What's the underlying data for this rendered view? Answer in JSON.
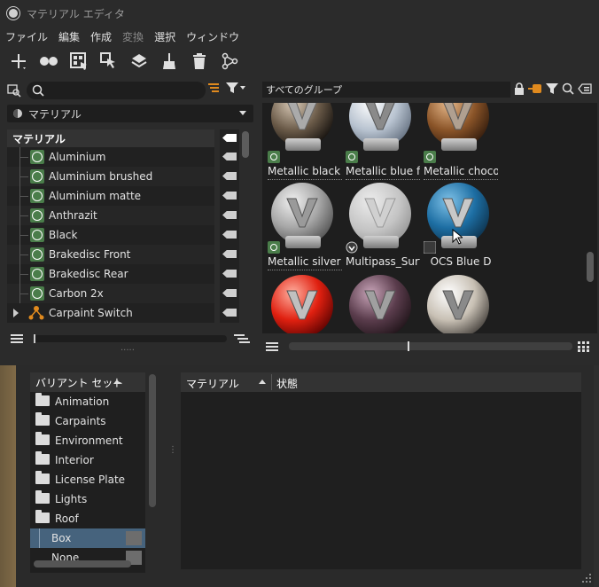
{
  "window": {
    "title": "マテリアル エディタ"
  },
  "menu": [
    {
      "label": "ファイル",
      "enabled": true
    },
    {
      "label": "編集",
      "enabled": true
    },
    {
      "label": "作成",
      "enabled": true
    },
    {
      "label": "変換",
      "enabled": false
    },
    {
      "label": "選択",
      "enabled": true
    },
    {
      "label": "ウィンドウ",
      "enabled": true
    }
  ],
  "toolbar": [
    {
      "name": "add-icon"
    },
    {
      "name": "group-icon"
    },
    {
      "name": "select-icon"
    },
    {
      "name": "pick-icon"
    },
    {
      "name": "assign-icon"
    },
    {
      "name": "sweep-icon"
    },
    {
      "name": "delete-icon"
    },
    {
      "name": "graph-icon"
    }
  ],
  "left": {
    "search_placeholder": "",
    "dropdown": "マテリアル",
    "tree_header": "マテリアル",
    "items": [
      {
        "label": "Aluminium",
        "type": "material"
      },
      {
        "label": "Aluminium brushed",
        "type": "material"
      },
      {
        "label": "Aluminium matte",
        "type": "material"
      },
      {
        "label": "Anthrazit",
        "type": "material"
      },
      {
        "label": "Black",
        "type": "material"
      },
      {
        "label": "Brakedisc Front",
        "type": "material"
      },
      {
        "label": "Brakedisc Rear",
        "type": "material"
      },
      {
        "label": "Carbon 2x",
        "type": "material"
      },
      {
        "label": "Carpaint Switch",
        "type": "switch"
      }
    ]
  },
  "right": {
    "group": "すべてのグループ",
    "materials": [
      {
        "label": "Metallic black",
        "checked": true
      },
      {
        "label": "Metallic blue fi",
        "checked": true
      },
      {
        "label": "Metallic chocol",
        "checked": true
      },
      {
        "label": "Metallic silver d",
        "checked": true
      },
      {
        "label": "Multipass_Surf",
        "checked": false
      },
      {
        "label": "OCS Blue D",
        "checked": false
      },
      {
        "label": "",
        "checked": false
      },
      {
        "label": "",
        "checked": false
      },
      {
        "label": "",
        "checked": false
      }
    ]
  },
  "variants": {
    "header": "バリアント セット",
    "items": [
      {
        "label": "Animation"
      },
      {
        "label": "Carpaints"
      },
      {
        "label": "Environment"
      },
      {
        "label": "Interior"
      },
      {
        "label": "License Plate"
      },
      {
        "label": "Lights"
      },
      {
        "label": "Roof"
      },
      {
        "label": "Box",
        "selected": true
      },
      {
        "label": "None"
      }
    ]
  },
  "state_table": {
    "col_material": "マテリアル",
    "col_state": "状態"
  }
}
